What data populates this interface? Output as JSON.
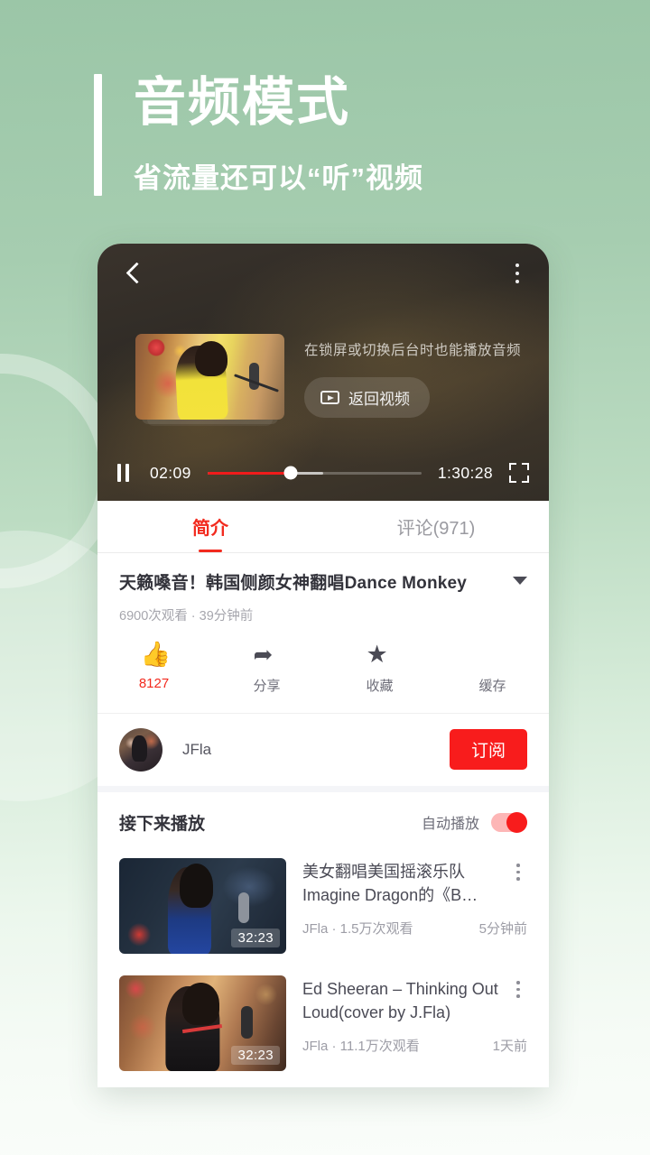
{
  "header": {
    "title": "音频模式",
    "subtitle": "省流量还可以“听”视频"
  },
  "player": {
    "note": "在锁屏或切换后台时也能播放音频",
    "back_to_video_label": "返回视频",
    "current_time": "02:09",
    "total_time": "1:30:28",
    "progress_percent": 39,
    "buffered_percent": 54,
    "icons": {
      "back": "chevron-left-icon",
      "menu": "kebab-menu-icon",
      "pause": "pause-icon",
      "fullscreen": "fullscreen-icon",
      "play_box": "play-box-icon"
    },
    "accent_color": "#f01b1b"
  },
  "tabs": [
    {
      "label": "简介",
      "active": true
    },
    {
      "label": "评论(971)",
      "active": false
    }
  ],
  "video": {
    "title": "天籁嗓音！韩国侧颜女神翻唱Dance Monkey",
    "meta": "6900次观看 · 39分钟前",
    "expand_icon": "chevron-down-icon"
  },
  "actions": [
    {
      "icon": "thumbs-up-icon",
      "label": "8127",
      "liked": true
    },
    {
      "icon": "share-icon",
      "label": "分享",
      "liked": false
    },
    {
      "icon": "star-icon",
      "label": "收藏",
      "liked": false
    },
    {
      "icon": "download-icon",
      "label": "缓存",
      "liked": false
    }
  ],
  "channel": {
    "name": "JFla",
    "subscribe_label": "订阅",
    "subscribe_color": "#f81c1c"
  },
  "upnext": {
    "title": "接下来播放",
    "autoplay_label": "自动播放",
    "autoplay_on": true,
    "items": [
      {
        "title": "美女翻唱美国摇滚乐队Imagine Dragon的《B…",
        "duration": "32:23",
        "channel_views": "JFla · 1.5万次观看",
        "time": "5分钟前"
      },
      {
        "title": "Ed Sheeran – Thinking Out Loud(cover by J.Fla)",
        "duration": "32:23",
        "channel_views": "JFla · 11.1万次观看",
        "time": "1天前"
      }
    ]
  }
}
